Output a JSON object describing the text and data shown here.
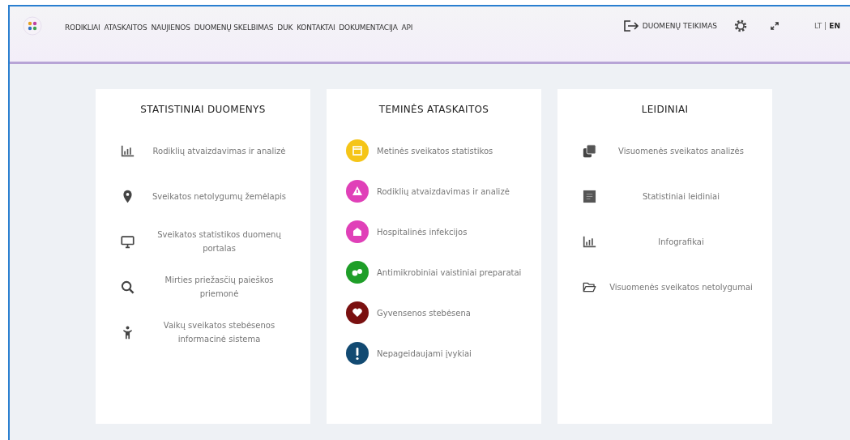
{
  "nav": {
    "links": [
      "RODIKLIAI",
      "ATASKAITOS",
      "NAUJIENOS",
      "DUOMENŲ SKELBIMAS",
      "DUK",
      "KONTAKTAI",
      "DOKUMENTACIJA",
      "API"
    ],
    "submit": "DUOMENŲ TEIKIMAS",
    "languages": [
      {
        "label": "LT",
        "selected": false
      },
      {
        "label": "EN",
        "selected": true
      }
    ]
  },
  "cards": [
    {
      "title": "STATISTINIAI DUOMENYS",
      "items": [
        {
          "label": "Rodiklių atvaizdavimas ir analizė"
        },
        {
          "label": "Sveikatos netolygumų žemėlapis"
        },
        {
          "label": "Sveikatos statistikos duomenų portalas"
        },
        {
          "label": "Mirties priežasčių paieškos priemonė"
        },
        {
          "label": "Vaikų sveikatos stebėsenos informacinė sistema"
        }
      ]
    },
    {
      "title": "TEMINĖS ATASKAITOS",
      "items": [
        {
          "label": "Metinės sveikatos statistikos",
          "color": "#f5c518"
        },
        {
          "label": "Rodiklių atvaizdavimas ir analizė",
          "color": "#e040b8"
        },
        {
          "label": "Hospitalinės infekcijos",
          "color": "#e040b8"
        },
        {
          "label": "Antimikrobiniai vaistiniai preparatai",
          "color": "#1e9e28"
        },
        {
          "label": "Gyvensenos stebėsena",
          "color": "#7a1010"
        },
        {
          "label": "Nepageidaujami įvykiai",
          "color": "#124a72"
        }
      ]
    },
    {
      "title": "LEIDINIAI",
      "items": [
        {
          "label": "Visuomenės sveikatos analizės"
        },
        {
          "label": "Statistiniai leidiniai"
        },
        {
          "label": "Infografikai"
        },
        {
          "label": "Visuomenės sveikatos netolygumai"
        }
      ]
    }
  ]
}
